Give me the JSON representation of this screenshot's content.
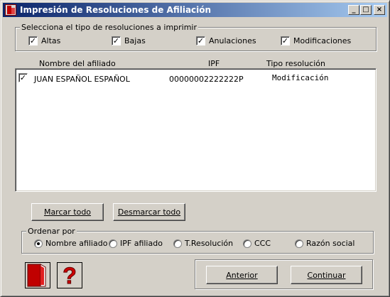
{
  "window": {
    "title": "Impresión de Resoluciones de Afiliación",
    "minimize_glyph": "_",
    "maximize_glyph": "□",
    "close_glyph": "×"
  },
  "filter_group": {
    "legend": "Selecciona el tipo de resoluciones a imprimir",
    "options": [
      {
        "label": "Altas",
        "checked": true
      },
      {
        "label": "Bajas",
        "checked": true
      },
      {
        "label": "Anulaciones",
        "checked": true
      },
      {
        "label": "Modificaciones",
        "checked": true
      }
    ]
  },
  "list": {
    "columns": [
      "Nombre del afiliado",
      "IPF",
      "Tipo resolución"
    ],
    "rows": [
      {
        "checked": true,
        "name": "JUAN ESPAÑOL ESPAÑOL",
        "ipf": "00000002222222P",
        "tipo": "Modificación"
      }
    ]
  },
  "actions": {
    "mark_all": "Marcar todo",
    "unmark_all": "Desmarcar todo"
  },
  "sort_group": {
    "legend": "Ordenar por",
    "options": [
      {
        "label": "Nombre afiliado",
        "selected": true
      },
      {
        "label": "IPF afiliado",
        "selected": false
      },
      {
        "label": "T.Resolución",
        "selected": false
      },
      {
        "label": "CCC",
        "selected": false
      },
      {
        "label": "Razón social",
        "selected": false
      }
    ]
  },
  "footer": {
    "exit_icon": "door-exit-icon",
    "help_icon": "help-question-icon",
    "help_glyph": "?",
    "back_button": "Anterior",
    "continue_button": "Continuar"
  },
  "check_glyph": "✓",
  "colors": {
    "titlebar_start": "#0a246a",
    "titlebar_end": "#a6caf0",
    "face": "#d4d0c8",
    "exit_red": "#c00000",
    "help_red": "#cc0000"
  }
}
